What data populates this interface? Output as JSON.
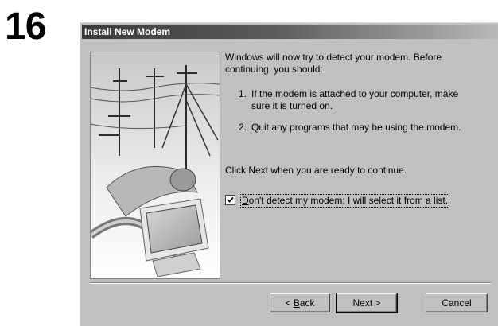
{
  "step_number": "16",
  "dialog": {
    "title": "Install New Modem",
    "intro": "Windows will now try to detect your modem.  Before continuing, you should:",
    "steps": [
      {
        "num": "1.",
        "text": "If the modem is attached to your computer, make sure it is turned on."
      },
      {
        "num": "2.",
        "text": "Quit any programs that may be using the modem."
      }
    ],
    "click_next": "Click Next when you are ready to continue.",
    "checkbox": {
      "checked": true,
      "mnemonic": "D",
      "label_rest": "on't detect my modem; I will select it from a list."
    },
    "buttons": {
      "back_prefix": "< ",
      "back_mnemonic": "B",
      "back_rest": "ack",
      "next": "Next >",
      "cancel": "Cancel"
    }
  }
}
